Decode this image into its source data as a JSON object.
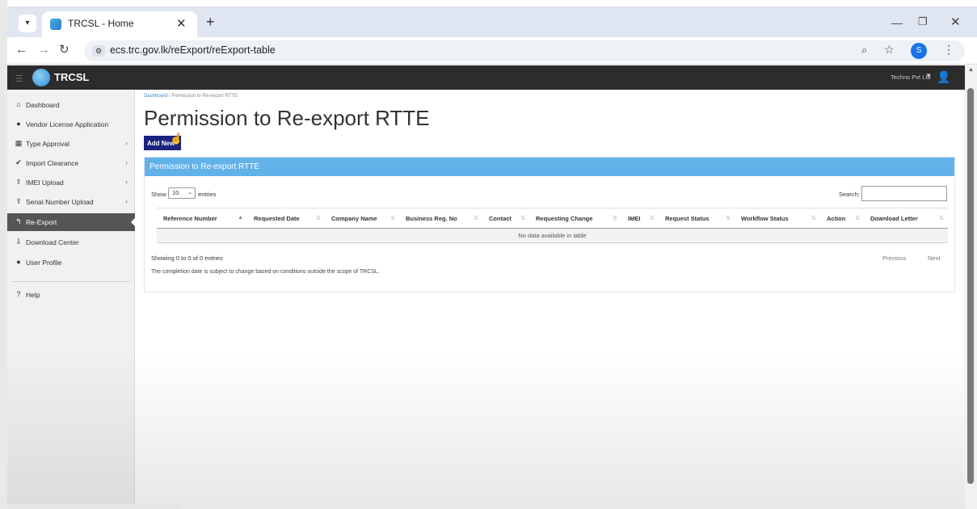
{
  "browser": {
    "tab_title": "TRCSL - Home",
    "url": "ecs.trc.gov.lk/reExport/reExport-table",
    "profile_initial": "S"
  },
  "app": {
    "brand": "TRCSL",
    "user_name": "Techno Pvt Ltd"
  },
  "sidebar": {
    "items": [
      {
        "label": "Dashboard",
        "icon": "home-icon",
        "has_chevron": false,
        "active": false
      },
      {
        "label": "Vendor License Application",
        "icon": "user-icon",
        "has_chevron": false,
        "active": false
      },
      {
        "label": "Type Approval",
        "icon": "table-icon",
        "has_chevron": true,
        "active": false
      },
      {
        "label": "Import Clearance",
        "icon": "check-circle-icon",
        "has_chevron": true,
        "active": false
      },
      {
        "label": "IMEI Upload",
        "icon": "upload-icon",
        "has_chevron": true,
        "active": false
      },
      {
        "label": "Serial Number Upload",
        "icon": "upload-icon",
        "has_chevron": true,
        "active": false
      },
      {
        "label": "Re-Export",
        "icon": "reply-icon",
        "has_chevron": false,
        "active": true
      },
      {
        "label": "Download Center",
        "icon": "download-icon",
        "has_chevron": false,
        "active": false
      },
      {
        "label": "User Profile",
        "icon": "user-icon",
        "has_chevron": false,
        "active": false
      }
    ],
    "help_label": "Help"
  },
  "main": {
    "breadcrumb_home": "Dashboard",
    "breadcrumb_sep": "/",
    "breadcrumb_current": "Permission to Re-export RTTE",
    "title": "Permission to Re-export RTTE",
    "add_button": "Add New",
    "panel_title": "Permission to Re-export RTTE",
    "show_label": "Show",
    "page_length": "10",
    "entries_label": "entries",
    "search_label": "Search:",
    "search_value": "",
    "columns": [
      "Reference Number",
      "Requested Date",
      "Company Name",
      "Business Reg. No",
      "Contact",
      "Requesting Change",
      "IMEI",
      "Request Status",
      "Workflow Status",
      "Action",
      "Download Letter"
    ],
    "empty_message": "No data available in table",
    "info": "Showing 0 to 0 of 0 entries",
    "note": "The completion date is subject to change based on conditions outside the scope of TRCSL.",
    "prev": "Previous",
    "next": "Next"
  },
  "colors": {
    "header_bg": "#2c2c2c",
    "panel_head": "#62b2ea",
    "add_button": "#1a237e",
    "sidebar_active": "#555555"
  }
}
